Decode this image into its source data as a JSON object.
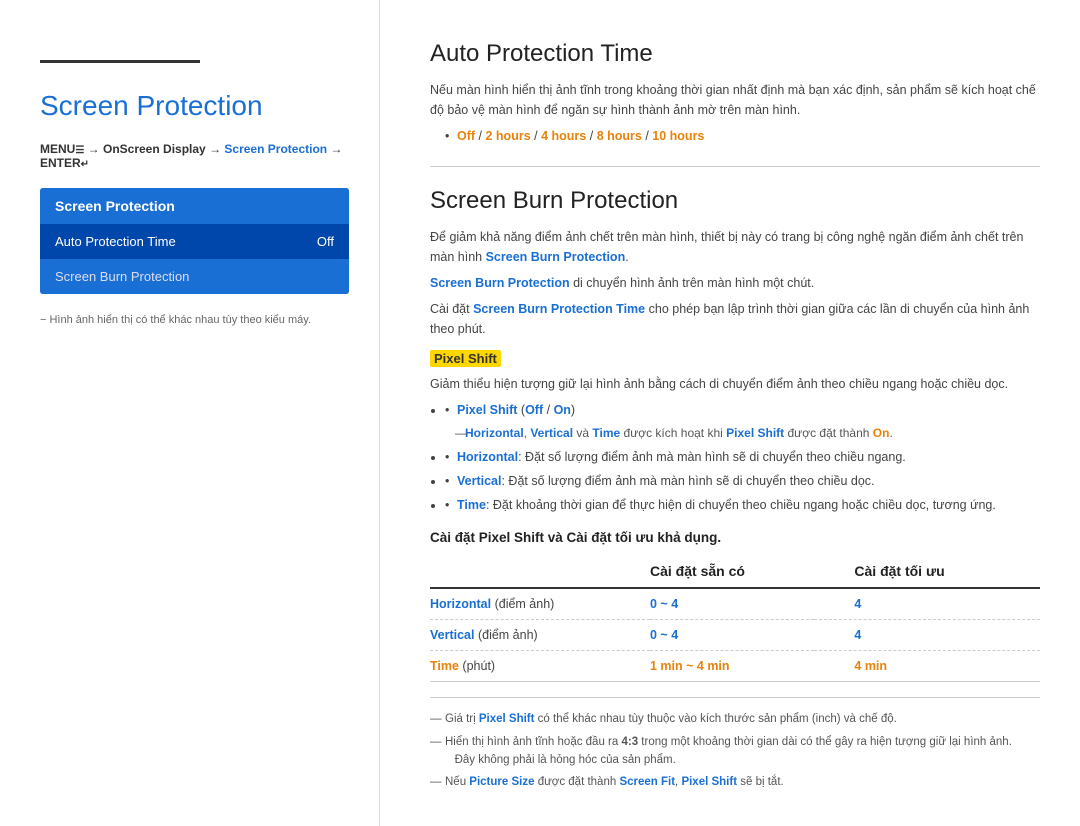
{
  "left": {
    "pageTitle": "Screen Protection",
    "breadcrumb": {
      "prefix": "MENU",
      "menuSymbol": "☰",
      "arrow1": " → ",
      "part1": "OnScreen Display",
      "arrow2": " → ",
      "part2": "Screen Protection",
      "arrow3": " → ",
      "part3": "ENTER",
      "enterSymbol": "↵"
    },
    "menuBox": {
      "header": "Screen Protection",
      "items": [
        {
          "label": "Auto Protection Time",
          "value": "Off",
          "active": true
        },
        {
          "label": "Screen Burn Protection",
          "active": false
        }
      ]
    },
    "footnote": "−  Hình ảnh hiển thị có thể khác nhau tùy theo kiểu máy."
  },
  "right": {
    "section1": {
      "title": "Auto Protection Time",
      "desc": "Nếu màn hình hiển thị ảnh tĩnh trong khoảng thời gian nhất định mà bạn xác định, sản phẩm sẽ kích hoạt chế độ bảo vệ màn hình để ngăn sự hình thành ảnh mờ trên màn hình.",
      "options": {
        "prefix": "Off",
        "items": [
          " / ",
          "2 hours",
          " / ",
          "4 hours",
          " / ",
          "8 hours",
          " / ",
          "10 hours"
        ]
      }
    },
    "section2": {
      "title": "Screen Burn Protection",
      "desc1": "Để giảm khả năng điểm ảnh chết trên màn hình, thiết bị này có trang bị công nghệ ngăn điểm ảnh chết trên màn hình Screen Burn Protection.",
      "desc2": "Screen Burn Protection di chuyển hình ảnh trên màn hình một chút.",
      "desc3": "Cài đặt Screen Burn Protection Time cho phép bạn lập trình thời gian giữa các lần di chuyển của hình ảnh theo phút.",
      "pixelShift": {
        "label": "Pixel Shift",
        "desc": "Giảm thiểu hiện tượng giữ lại hình ảnh bằng cách di chuyển điểm ảnh theo chiều ngang hoặc chiều dọc.",
        "bullets": [
          "Pixel Shift (Off / On)",
          "Horizontal, Vertical và Time được kích hoạt khi Pixel Shift được đặt thành On.",
          "Horizontal: Đặt số lượng điểm ảnh mà màn hình sẽ di chuyển theo chiều ngang.",
          "Vertical: Đặt số lượng điểm ảnh mà màn hình sẽ di chuyển theo chiều dọc.",
          "Time: Đặt khoảng thời gian để thực hiện di chuyển theo chiều ngang hoặc chiều dọc, tương ứng."
        ],
        "subNote": "Horizontal, Vertical và Time được kích hoạt khi Pixel Shift được đặt thành On."
      }
    },
    "tableSection": {
      "heading": "Cài đặt Pixel Shift và Cài đặt tối ưu khả dụng.",
      "headers": [
        "",
        "Cài đặt sẵn có",
        "Cài đặt tối ưu"
      ],
      "rows": [
        {
          "label": "Horizontal",
          "unit": "(điểm ảnh)",
          "available": "0 ~ 4",
          "optimal": "4",
          "isTime": false
        },
        {
          "label": "Vertical",
          "unit": "(điểm ảnh)",
          "available": "0 ~ 4",
          "optimal": "4",
          "isTime": false
        },
        {
          "label": "Time",
          "unit": "(phút)",
          "available": "1 min ~ 4 min",
          "optimal": "4 min",
          "isTime": true
        }
      ]
    },
    "footnotes": [
      "Giá trị Pixel Shift có thể khác nhau tùy thuộc vào kích thước sản phẩm (inch) và chế độ.",
      "Hiển thị hình ảnh tĩnh hoặc đầu ra 4:3 trong một khoảng thời gian dài có thể gây ra hiện tượng giữ lại hình ảnh. Đây không phải là hỏng hóc của sản phẩm.",
      "Nếu Picture Size được đặt thành Screen Fit, Pixel Shift sẽ bị tắt."
    ]
  }
}
